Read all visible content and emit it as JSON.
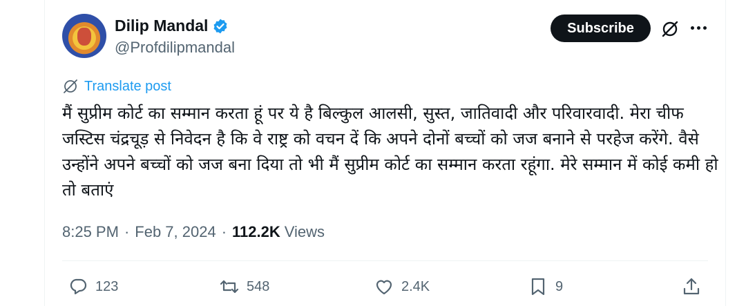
{
  "author": {
    "name": "Dilip Mandal",
    "handle": "@Profdilipmandal",
    "verified_icon": "verified-badge-icon",
    "verified_color": "#1d9bf0"
  },
  "header_actions": {
    "subscribe_label": "Subscribe",
    "grok_icon": "grok-icon",
    "more_icon": "more-options-icon"
  },
  "translate": {
    "label": "Translate post",
    "icon": "translate-globe-icon"
  },
  "post": {
    "text": "मैं सुप्रीम कोर्ट का सम्मान करता हूं पर ये है बिल्कुल आलसी, सुस्त, जातिवादी और परिवारवादी. मेरा चीफ जस्टिस चंद्रचूड़ से निवेदन है कि वे राष्ट्र को वचन दें कि अपने दोनों बच्चों को जज बनाने से परहेज करेंगे. वैसे उन्होंने अपने बच्चों को जज बना दिया तो भी मैं सुप्रीम कोर्ट का सम्मान करता रहूंगा. मेरे सम्मान में कोई कमी हो तो बताएं"
  },
  "meta": {
    "time": "8:25 PM",
    "separator": "·",
    "date": "Feb 7, 2024",
    "views_count": "112.2K",
    "views_label": "Views"
  },
  "actions": {
    "replies": "123",
    "reposts": "548",
    "likes": "2.4K",
    "bookmarks": "9"
  },
  "colors": {
    "text": "#0f1419",
    "muted": "#536471",
    "accent": "#1d9bf0"
  }
}
